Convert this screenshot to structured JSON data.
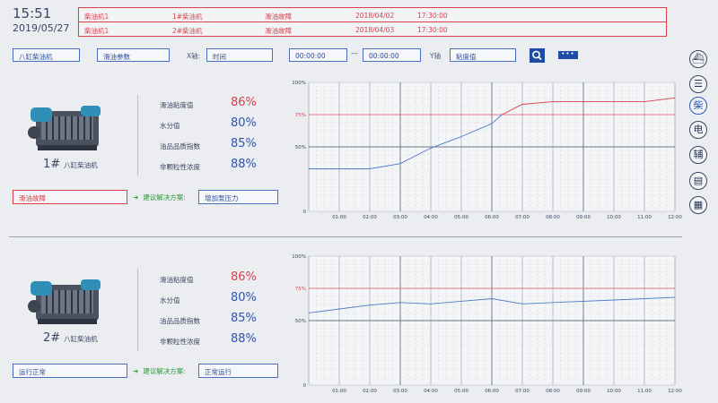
{
  "clock": {
    "time": "15:51",
    "date": "2019/05/27"
  },
  "alarms": [
    {
      "device": "柴油机1",
      "engine": "1#柴油机",
      "type": "滑油故障",
      "date": "2018/04/02",
      "time": "17:30:00"
    },
    {
      "device": "柴油机1",
      "engine": "2#柴油机",
      "type": "滑油故障",
      "date": "2018/04/03",
      "time": "17:30:00"
    }
  ],
  "toolbar": {
    "engine_select": "八缸柴油机",
    "param_select": "滑油参数",
    "x_label": "X轴:",
    "x_value": "时间",
    "time_from": "00:00:00",
    "dash": "—",
    "time_to": "00:00:00",
    "y_label": "Y轴",
    "y_value": "粘度值",
    "more": "•••"
  },
  "sidebar": {
    "items": [
      {
        "name": "ship",
        "glyph": "⛴"
      },
      {
        "name": "menu",
        "glyph": "☰"
      },
      {
        "name": "diesel",
        "glyph": "柴",
        "active": true
      },
      {
        "name": "electric",
        "glyph": "电"
      },
      {
        "name": "auxiliary",
        "glyph": "辅"
      },
      {
        "name": "document",
        "glyph": "▤"
      },
      {
        "name": "report",
        "glyph": "▦"
      }
    ]
  },
  "param_labels": [
    "滑油粘度值",
    "水分值",
    "油品品质指数",
    "非颗粒性浓度"
  ],
  "suggest_label": "建议解决方案:",
  "sections": [
    {
      "engine_no": "1#",
      "engine_name": "八缸柴油机",
      "params": [
        "86%",
        "80%",
        "85%",
        "88%"
      ],
      "status": "滑油故障",
      "status_kind": "fault",
      "solution": "增加泵压力"
    },
    {
      "engine_no": "2#",
      "engine_name": "八缸柴油机",
      "params": [
        "86%",
        "80%",
        "85%",
        "88%"
      ],
      "status": "运行正常",
      "status_kind": "ok",
      "solution": "正常运行"
    }
  ],
  "chart_data": [
    {
      "type": "line",
      "x": [
        "00:00",
        "01:00",
        "02:00",
        "03:00",
        "04:00",
        "05:00",
        "06:00",
        "06:20",
        "07:00",
        "08:00",
        "09:00",
        "10:00",
        "11:00",
        "12:00"
      ],
      "ylim": [
        0,
        100
      ],
      "yticks": [
        "0",
        "50%",
        "75%",
        "100%"
      ],
      "xticks": [
        "01:00",
        "02:00",
        "03:00",
        "04:00",
        "05:00",
        "06:00",
        "07:00",
        "08:00",
        "09:00",
        "10:00",
        "11:00",
        "12:00"
      ],
      "threshold": 75,
      "series": [
        {
          "values": [
            33,
            33,
            33,
            37,
            49,
            58,
            68,
            75,
            null,
            null,
            null,
            null,
            null,
            null
          ],
          "color": "#4f7bc7"
        },
        {
          "values": [
            null,
            null,
            null,
            null,
            null,
            null,
            null,
            75,
            83,
            85,
            85,
            85,
            85,
            88
          ],
          "color": "#d9404a"
        }
      ]
    },
    {
      "type": "line",
      "x": [
        "00:00",
        "01:00",
        "02:00",
        "03:00",
        "04:00",
        "05:00",
        "06:00",
        "07:00",
        "08:00",
        "09:00",
        "10:00",
        "11:00",
        "12:00"
      ],
      "ylim": [
        0,
        100
      ],
      "yticks": [
        "0",
        "50%",
        "75%",
        "100%"
      ],
      "xticks": [
        "01:00",
        "02:00",
        "03:00",
        "04:00",
        "05:00",
        "06:00",
        "07:00",
        "08:00",
        "09:00",
        "10:00",
        "11:00",
        "12:00"
      ],
      "threshold": 75,
      "series": [
        {
          "values": [
            56,
            59,
            62,
            64,
            63,
            65,
            67,
            63,
            64,
            65,
            66,
            67,
            68
          ],
          "color": "#4f7bc7"
        }
      ]
    }
  ]
}
